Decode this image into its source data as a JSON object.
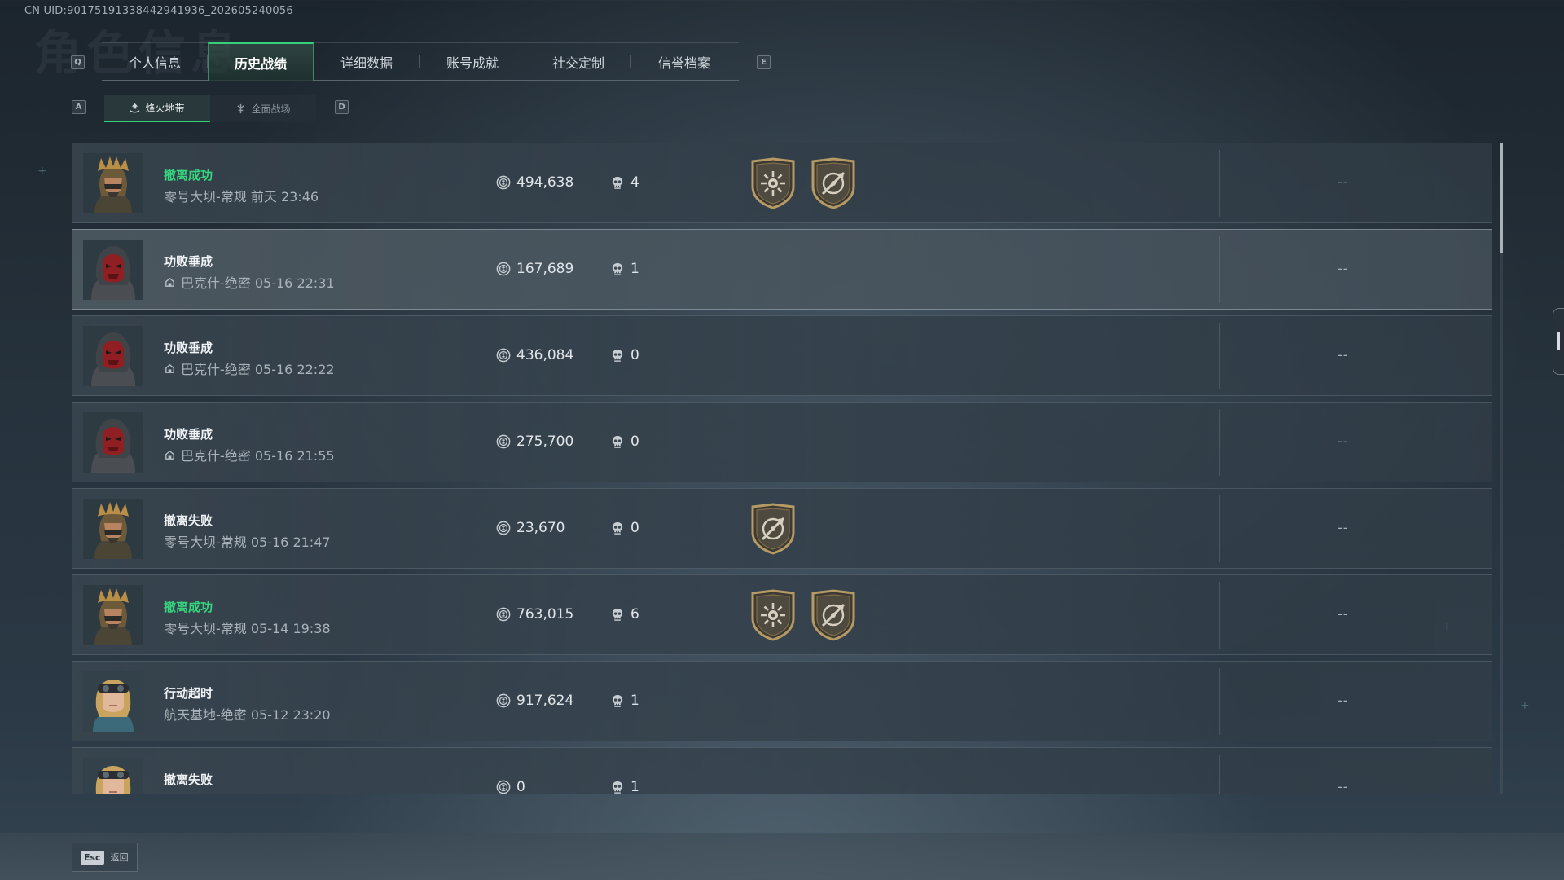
{
  "uid": "CN UID:9017519133844294193​6_202605240056",
  "watermark": "角色信息",
  "nav_keys": {
    "prev_tab": "Q",
    "next_tab": "E",
    "prev_sub": "A",
    "next_sub": "D"
  },
  "tabs": [
    {
      "label": "个人信息"
    },
    {
      "label": "历史战绩"
    },
    {
      "label": "详细数据"
    },
    {
      "label": "账号成就"
    },
    {
      "label": "社交定制"
    },
    {
      "label": "信誉档案"
    }
  ],
  "subtabs": [
    {
      "label": "烽火地带"
    },
    {
      "label": "全面战场"
    }
  ],
  "matches": [
    {
      "result": "撤离成功",
      "status": "success",
      "map": "零号大坝-常规 前天 23:46",
      "value": "494,638",
      "kills": "4",
      "badges": [
        "sun-badge-icon",
        "compass-badge-icon"
      ],
      "extra": "--",
      "avatar": "gold"
    },
    {
      "result": "功败垂成",
      "status": "fail",
      "map": "巴克什-绝密 05-16 22:31",
      "value": "167,689",
      "kills": "1",
      "badges": [],
      "extra": "--",
      "avatar": "hood",
      "mode_icon": true
    },
    {
      "result": "功败垂成",
      "status": "fail",
      "map": "巴克什-绝密 05-16 22:22",
      "value": "436,084",
      "kills": "0",
      "badges": [],
      "extra": "--",
      "avatar": "hood",
      "mode_icon": true
    },
    {
      "result": "功败垂成",
      "status": "fail",
      "map": "巴克什-绝密 05-16 21:55",
      "value": "275,700",
      "kills": "0",
      "badges": [],
      "extra": "--",
      "avatar": "hood",
      "mode_icon": true
    },
    {
      "result": "撤离失败",
      "status": "fail",
      "map": "零号大坝-常规 05-16 21:47",
      "value": "23,670",
      "kills": "0",
      "badges": [
        "compass-badge-icon"
      ],
      "extra": "--",
      "avatar": "gold"
    },
    {
      "result": "撤离成功",
      "status": "success",
      "map": "零号大坝-常规 05-14 19:38",
      "value": "763,015",
      "kills": "6",
      "badges": [
        "sun-badge-icon",
        "compass-badge-icon"
      ],
      "extra": "--",
      "avatar": "gold"
    },
    {
      "result": "行动超时",
      "status": "fail",
      "map": "航天基地-绝密 05-12 23:20",
      "value": "917,624",
      "kills": "1",
      "badges": [],
      "extra": "--",
      "avatar": "blonde"
    },
    {
      "result": "撤离失败",
      "status": "fail",
      "map": "",
      "value": "0",
      "kills": "1",
      "badges": [],
      "extra": "--",
      "avatar": "blonde"
    }
  ],
  "footer": {
    "esc_key": "Esc",
    "back_label": "返回"
  },
  "colors": {
    "accent": "#35d67e",
    "text": "#dfe4e8"
  }
}
